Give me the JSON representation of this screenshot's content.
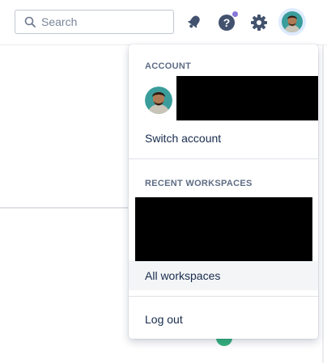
{
  "search": {
    "placeholder": "Search",
    "icon": "search-icon"
  },
  "topbar": {
    "icons": [
      "notification-icon",
      "help-icon",
      "settings-icon",
      "avatar"
    ],
    "help_badge_color": "#8777d9"
  },
  "menu": {
    "account_title": "ACCOUNT",
    "switch_account": "Switch account",
    "recent_title": "RECENT WORKSPACES",
    "all_workspaces": "All workspaces",
    "log_out": "Log out"
  },
  "colors": {
    "accent_green": "#36b37e",
    "text_primary": "#172b4d",
    "section_title": "#5e6c84"
  }
}
